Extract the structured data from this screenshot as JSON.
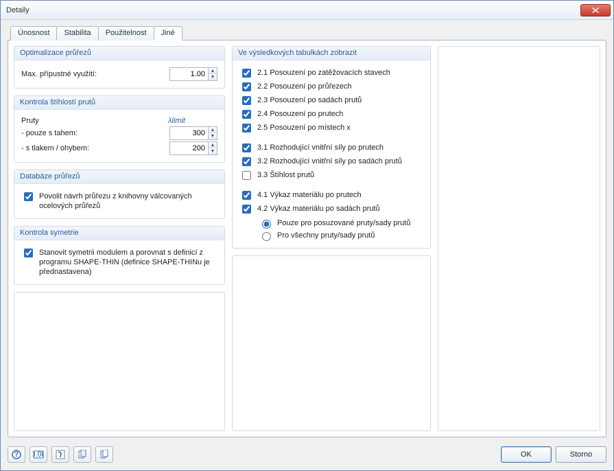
{
  "window": {
    "title": "Detaily"
  },
  "tabs": {
    "t0": "Únosnost",
    "t1": "Stabilita",
    "t2": "Použitelnost",
    "t3": "Jiné",
    "activeIndex": 3
  },
  "optim": {
    "title": "Optimalizace průřezů",
    "maxUtilLabel": "Max. přípustné využití:",
    "maxUtilValue": "1.00"
  },
  "slender": {
    "title": "Kontrola štíhlostí prutů",
    "colMembers": "Pruty",
    "colLimit": "λlimit",
    "tensionLabel": "- pouze s tahem:",
    "tensionValue": "300",
    "compLabel": "- s tlakem / ohybem:",
    "compValue": "200"
  },
  "db": {
    "title": "Databáze průřezů",
    "allowLabel": "Povolit návrh průřezu z knihovny válcovaných ocelových průřezů"
  },
  "sym": {
    "title": "Kontrola symetrie",
    "chkLabel": "Stanovit symetrii modulem a porovnat s definicí z programu SHAPE-THIN (definice SHAPE-THINu je přednastavena)"
  },
  "results": {
    "title": "Ve výsledkových tabulkách zobrazit",
    "i21": "2.1 Posouzení po zatěžovacích stavech",
    "i22": "2.2 Posouzení po průřezech",
    "i23": "2.3 Posouzení po sadách prutů",
    "i24": "2.4 Posouzení po prutech",
    "i25": "2.5 Posouzení po místech x",
    "i31": "3.1 Rozhodující vnitřní síly po prutech",
    "i32": "3.2 Rozhodující vnitřní síly po sadách prutů",
    "i33": "3.3 Štíhlost prutů",
    "i41": "4.1 Výkaz materiálu po prutech",
    "i42": "4.2 Výkaz materiálu po sadách prutů",
    "r1": "Pouze pro posuzované pruty/sady prutů",
    "r2": "Pro všechny pruty/sady prutů"
  },
  "footer": {
    "ok": "OK",
    "cancel": "Storno"
  }
}
